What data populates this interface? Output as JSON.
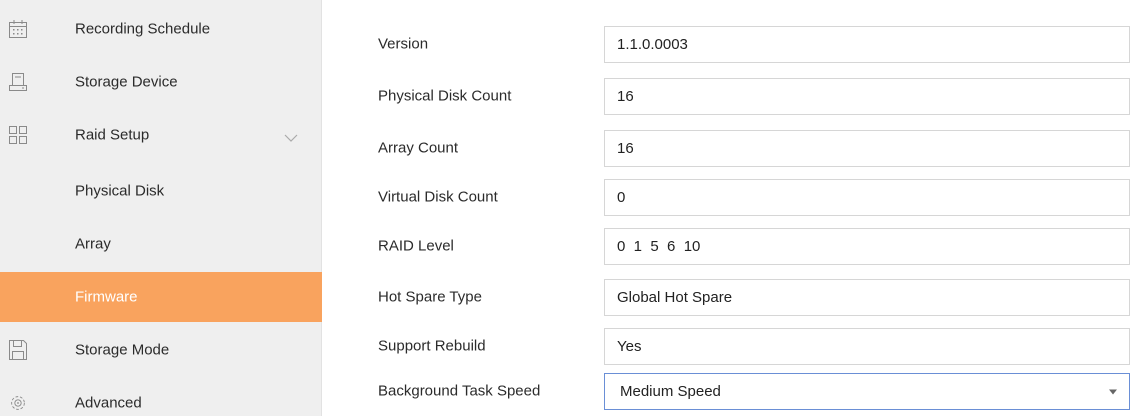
{
  "sidebar": {
    "items": [
      {
        "label": "Recording Schedule",
        "icon": "calendar-icon"
      },
      {
        "label": "Storage Device",
        "icon": "hard-drive-icon"
      },
      {
        "label": "Raid Setup",
        "icon": "grid-icon",
        "expanded": true
      },
      {
        "label": "Physical Disk"
      },
      {
        "label": "Array"
      },
      {
        "label": "Firmware",
        "active": true
      },
      {
        "label": "Storage Mode",
        "icon": "floppy-disk-icon"
      },
      {
        "label": "Advanced",
        "icon": "gear-icon"
      }
    ],
    "active_color": "#f9a35e"
  },
  "form": {
    "version": {
      "label": "Version",
      "value": "1.1.0.0003"
    },
    "physical_disk_count": {
      "label": "Physical Disk Count",
      "value": "16"
    },
    "array_count": {
      "label": "Array Count",
      "value": "16"
    },
    "virtual_disk_count": {
      "label": "Virtual Disk Count",
      "value": "0"
    },
    "raid_level": {
      "label": "RAID Level",
      "value": "0  1  5  6  10"
    },
    "hot_spare_type": {
      "label": "Hot Spare Type",
      "value": "Global Hot Spare"
    },
    "support_rebuild": {
      "label": "Support Rebuild",
      "value": "Yes"
    },
    "background_task_speed": {
      "label": "Background Task Speed",
      "value": "Medium Speed"
    }
  }
}
